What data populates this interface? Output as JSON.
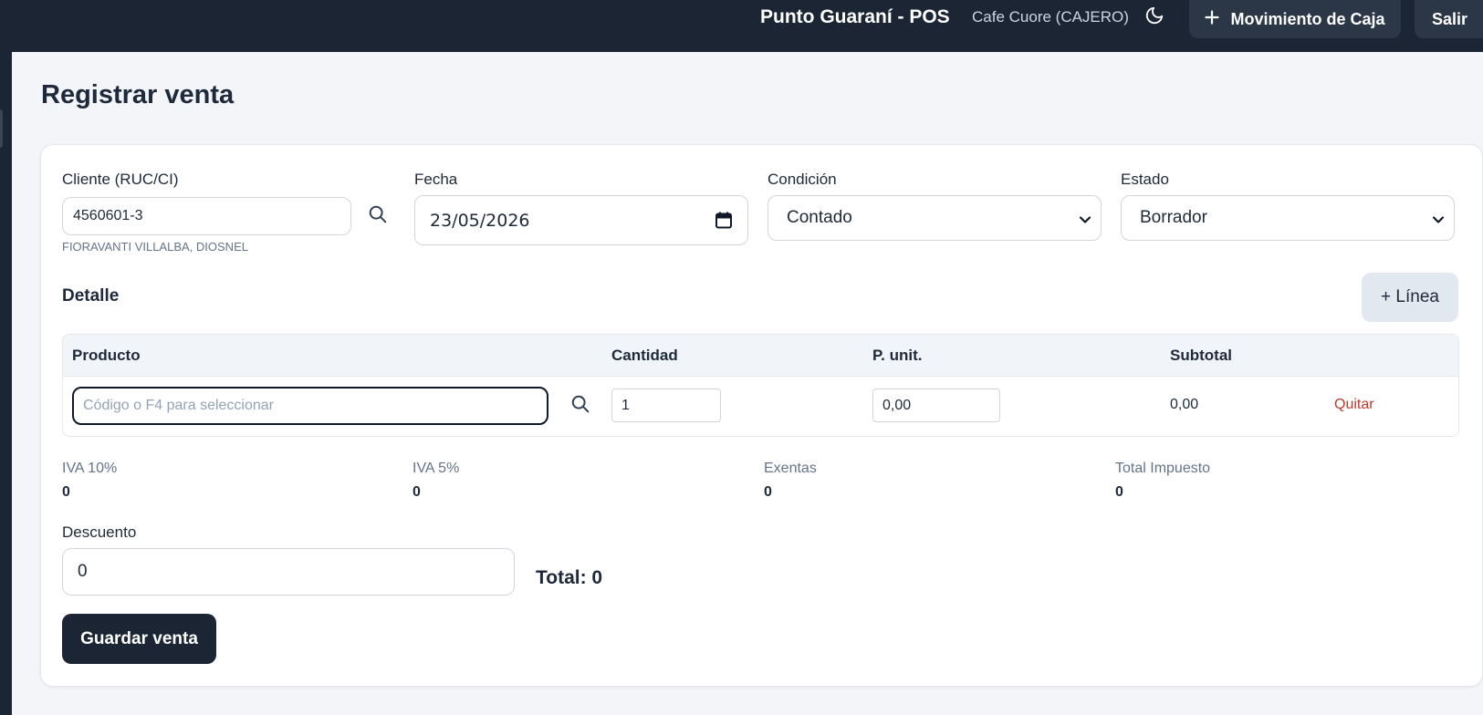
{
  "header": {
    "app_title": "Punto Guaraní - POS",
    "user": "Cafe Cuore (CAJERO)",
    "theme_icon": "moon-icon",
    "cash_movement_label": "Movimiento de Caja",
    "logout_label": "Salir"
  },
  "page": {
    "title": "Registrar venta"
  },
  "form": {
    "cliente": {
      "label": "Cliente (RUC/CI)",
      "value": "4560601-3",
      "name": "FIORAVANTI VILLALBA, DIOSNEL"
    },
    "fecha": {
      "label": "Fecha",
      "value": "23/05/2026"
    },
    "condicion": {
      "label": "Condición",
      "value": "Contado"
    },
    "estado": {
      "label": "Estado",
      "value": "Borrador"
    }
  },
  "detalle": {
    "title": "Detalle",
    "add_line_label": "+ Línea",
    "columns": [
      "Producto",
      "Cantidad",
      "P. unit.",
      "Subtotal"
    ],
    "row": {
      "product_placeholder": "Código o F4 para seleccionar",
      "cantidad": "1",
      "precio": "0,00",
      "subtotal": "0,00",
      "remove_label": "Quitar"
    }
  },
  "summary": {
    "iva10": {
      "label": "IVA 10%",
      "value": "0"
    },
    "iva5": {
      "label": "IVA 5%",
      "value": "0"
    },
    "exentas": {
      "label": "Exentas",
      "value": "0"
    },
    "total_impuesto": {
      "label": "Total Impuesto",
      "value": "0"
    }
  },
  "descuento": {
    "label": "Descuento",
    "value": "0"
  },
  "total_label": "Total: 0",
  "save_label": "Guardar venta",
  "colors": {
    "nav_bg": "#1c2533",
    "button_dark": "#2b3646",
    "danger": "#c0392b",
    "muted": "#64748b",
    "page_bg": "#f3f5f8"
  }
}
